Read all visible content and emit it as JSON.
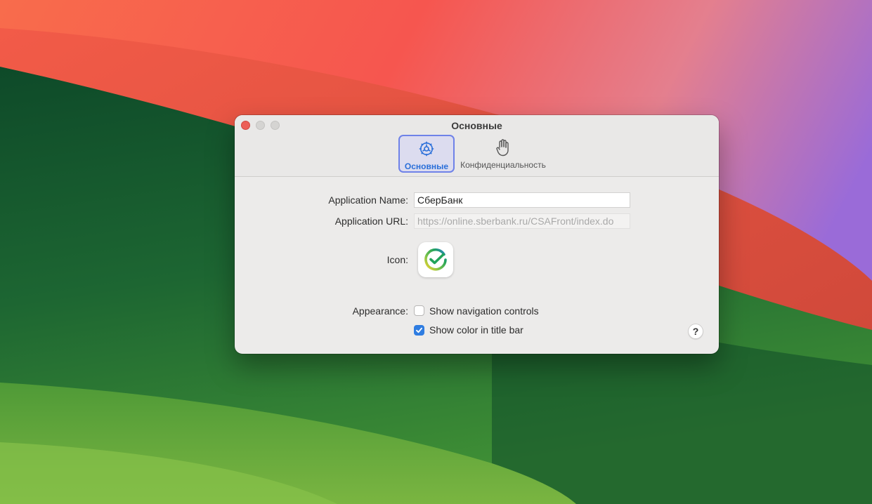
{
  "window": {
    "title": "Основные"
  },
  "tabs": [
    {
      "label": "Основные",
      "icon": "gear-icon",
      "selected": true
    },
    {
      "label": "Конфиденциальность",
      "icon": "hand-icon",
      "selected": false
    }
  ],
  "form": {
    "app_name_label": "Application Name:",
    "app_name_value": "СберБанк",
    "app_url_label": "Application URL:",
    "app_url_value": "https://online.sberbank.ru/CSAFront/index.do",
    "icon_label": "Icon:",
    "appearance_label": "Appearance:",
    "show_nav_label": "Show navigation controls",
    "show_nav_checked": false,
    "show_color_label": "Show color in title bar",
    "show_color_checked": true
  },
  "help_label": "?",
  "colors": {
    "accent": "#2f7de1",
    "close_button": "#ec5f57",
    "selected_tab_border": "#6f82e8"
  }
}
